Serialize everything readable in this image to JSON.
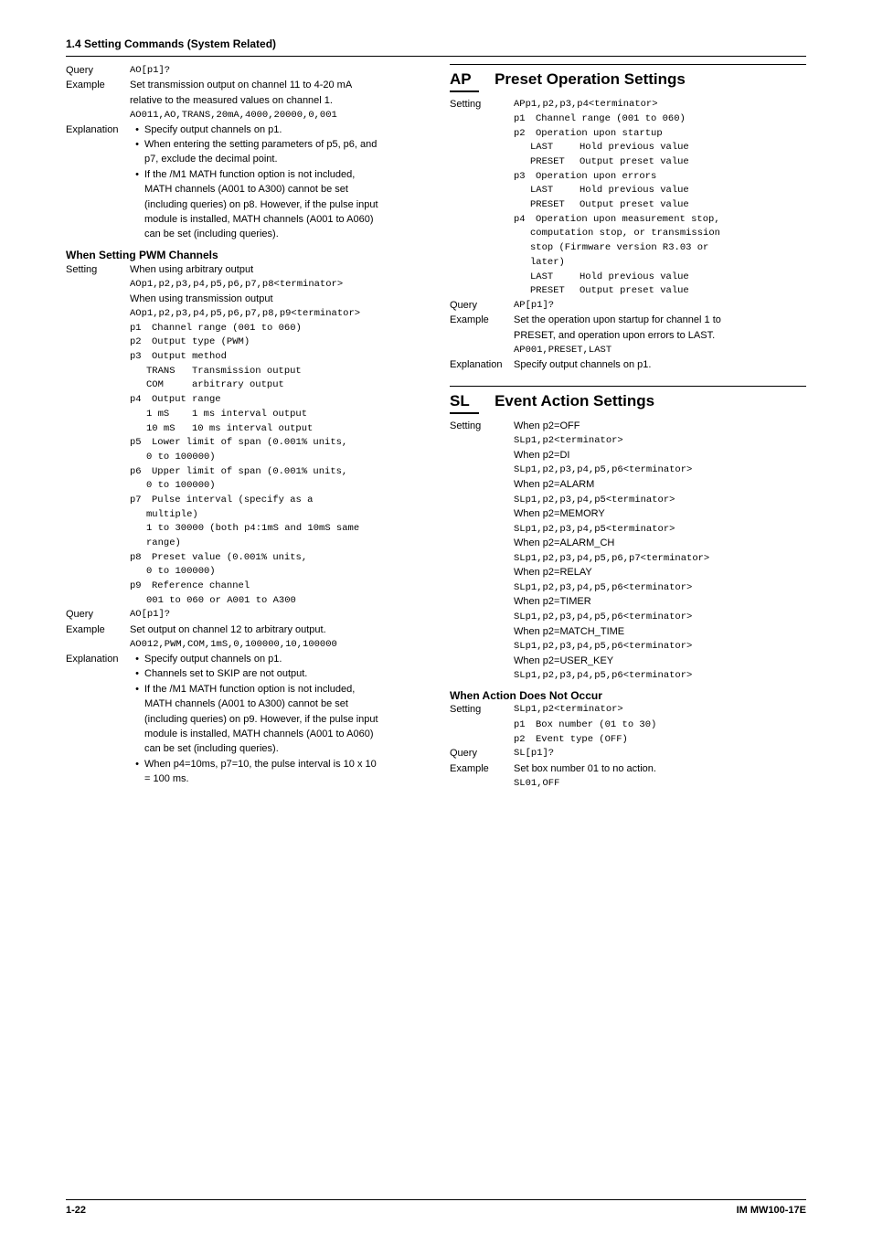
{
  "header": "1.4  Setting Commands (System Related)",
  "left": {
    "query1_lbl": "Query",
    "query1_val": "AO[p1]?",
    "example1_lbl": "Example",
    "example1_l1": "Set transmission output on channel 11 to 4-20 mA",
    "example1_l2": "relative to the measured values on channel 1.",
    "example1_l3": "AO011,AO,TRANS,20mA,4000,20000,0,001",
    "expl1_lbl": "Explanation",
    "expl1_b1": "Specify output channels on p1.",
    "expl1_b2a": "When entering the setting parameters of p5, p6, and",
    "expl1_b2b": "p7, exclude the decimal point.",
    "expl1_b3a": "If the /M1 MATH function option is not included,",
    "expl1_b3b": "MATH channels (A001 to A300) cannot be set",
    "expl1_b3c": "(including queries) on p8. However, if the pulse input",
    "expl1_b3d": "module is installed, MATH channels (A001 to A060)",
    "expl1_b3e": "can be set (including queries).",
    "pwm_head": "When Setting PWM Channels",
    "setting_lbl": "Setting",
    "setting_l1": "When using arbitrary output",
    "setting_l2": "AOp1,p2,p3,p4,p5,p6,p7,p8<terminator>",
    "setting_l3": "When using transmission output",
    "setting_l4": "AOp1,p2,p3,p4,p5,p6,p7,p8,p9<terminator>",
    "p1": "Channel range (001 to 060)",
    "p2": "Output type (PWM)",
    "p3": "Output method",
    "p3_trans": "Transmission output",
    "p3_com": "arbitrary output",
    "p4": "Output range",
    "p4_1ms": "1 ms interval output",
    "p4_10ms": "10 ms interval output",
    "p5a": "Lower limit of span (0.001% units,",
    "p5b": "0 to 100000)",
    "p6a": "Upper limit of span (0.001% units,",
    "p6b": "0 to 100000)",
    "p7a": "Pulse interval (specify as a",
    "p7b": "multiple)",
    "p7c": "1 to 30000 (both p4:1mS and 10mS same",
    "p7d": "range)",
    "p8a": "Preset value (0.001% units,",
    "p8b": "0 to 100000)",
    "p9a": "Reference channel",
    "p9b": "001 to 060 or A001 to A300",
    "query2_lbl": "Query",
    "query2_val": "AO[p1]?",
    "example2_lbl": "Example",
    "example2_l1": "Set output on channel 12 to arbitrary output.",
    "example2_l2": "AO012,PWM,COM,1mS,0,100000,10,100000",
    "expl2_lbl": "Explanation",
    "expl2_b1": "Specify output channels on p1.",
    "expl2_b2": "Channels set to SKIP are not output.",
    "expl2_b3a": "If the /M1 MATH function option is not included,",
    "expl2_b3b": "MATH channels (A001 to A300) cannot be set",
    "expl2_b3c": "(including queries) on p9. However, if the pulse input",
    "expl2_b3d": "module is installed, MATH channels (A001 to A060)",
    "expl2_b3e": "can be set (including queries).",
    "expl2_b4a": "When p4=10ms, p7=10, the pulse interval is 10 x 10",
    "expl2_b4b": "= 100 ms."
  },
  "right": {
    "ap_code": "AP",
    "ap_title": "Preset Operation Settings",
    "ap_setting_lbl": "Setting",
    "ap_setting": "APp1,p2,p3,p4<terminator>",
    "ap_p1": "Channel range (001 to 060)",
    "ap_p2": "Operation upon startup",
    "ap_last": "Hold previous value",
    "ap_preset": "Output preset value",
    "ap_p3": "Operation upon errors",
    "ap_p4a": "Operation upon measurement stop,",
    "ap_p4b": "computation stop, or transmission",
    "ap_p4c": "stop (Firmware version R3.03 or",
    "ap_p4d": "later)",
    "ap_query_lbl": "Query",
    "ap_query": "AP[p1]?",
    "ap_example_lbl": "Example",
    "ap_ex1": "Set the operation upon startup for channel 1 to",
    "ap_ex2": "PRESET, and operation upon errors to LAST.",
    "ap_ex3": "AP001,PRESET,LAST",
    "ap_expl_lbl": "Explanation",
    "ap_expl": "Specify output channels on p1.",
    "sl_code": "SL",
    "sl_title": "Event Action Settings",
    "sl_setting_lbl": "Setting",
    "sl_off_h": "When p2=OFF",
    "sl_off": "SLp1,p2<terminator>",
    "sl_di_h": "When p2=DI",
    "sl_di": "SLp1,p2,p3,p4,p5,p6<terminator>",
    "sl_alarm_h": "When p2=ALARM",
    "sl_alarm": "SLp1,p2,p3,p4,p5<terminator>",
    "sl_mem_h": "When p2=MEMORY",
    "sl_mem": "SLp1,p2,p3,p4,p5<terminator>",
    "sl_ach_h": "When p2=ALARM_CH",
    "sl_ach": "SLp1,p2,p3,p4,p5,p6,p7<terminator>",
    "sl_relay_h": "When p2=RELAY",
    "sl_relay": "SLp1,p2,p3,p4,p5,p6<terminator>",
    "sl_timer_h": "When p2=TIMER",
    "sl_timer": "SLp1,p2,p3,p4,p5,p6<terminator>",
    "sl_match_h": "When p2=MATCH_TIME",
    "sl_match": "SLp1,p2,p3,p4,p5,p6<terminator>",
    "sl_user_h": "When p2=USER_KEY",
    "sl_user": "SLp1,p2,p3,p4,p5,p6<terminator>",
    "noaction_head": "When Action Does Not Occur",
    "na_setting_lbl": "Setting",
    "na_setting": "SLp1,p2<terminator>",
    "na_p1": "Box number (01 to 30)",
    "na_p2": "Event type (OFF)",
    "na_query_lbl": "Query",
    "na_query": "SL[p1]?",
    "na_example_lbl": "Example",
    "na_ex1": "Set box number 01 to no action.",
    "na_ex2": "SL01,OFF"
  },
  "footer": {
    "left": "1-22",
    "right": "IM MW100-17E"
  }
}
